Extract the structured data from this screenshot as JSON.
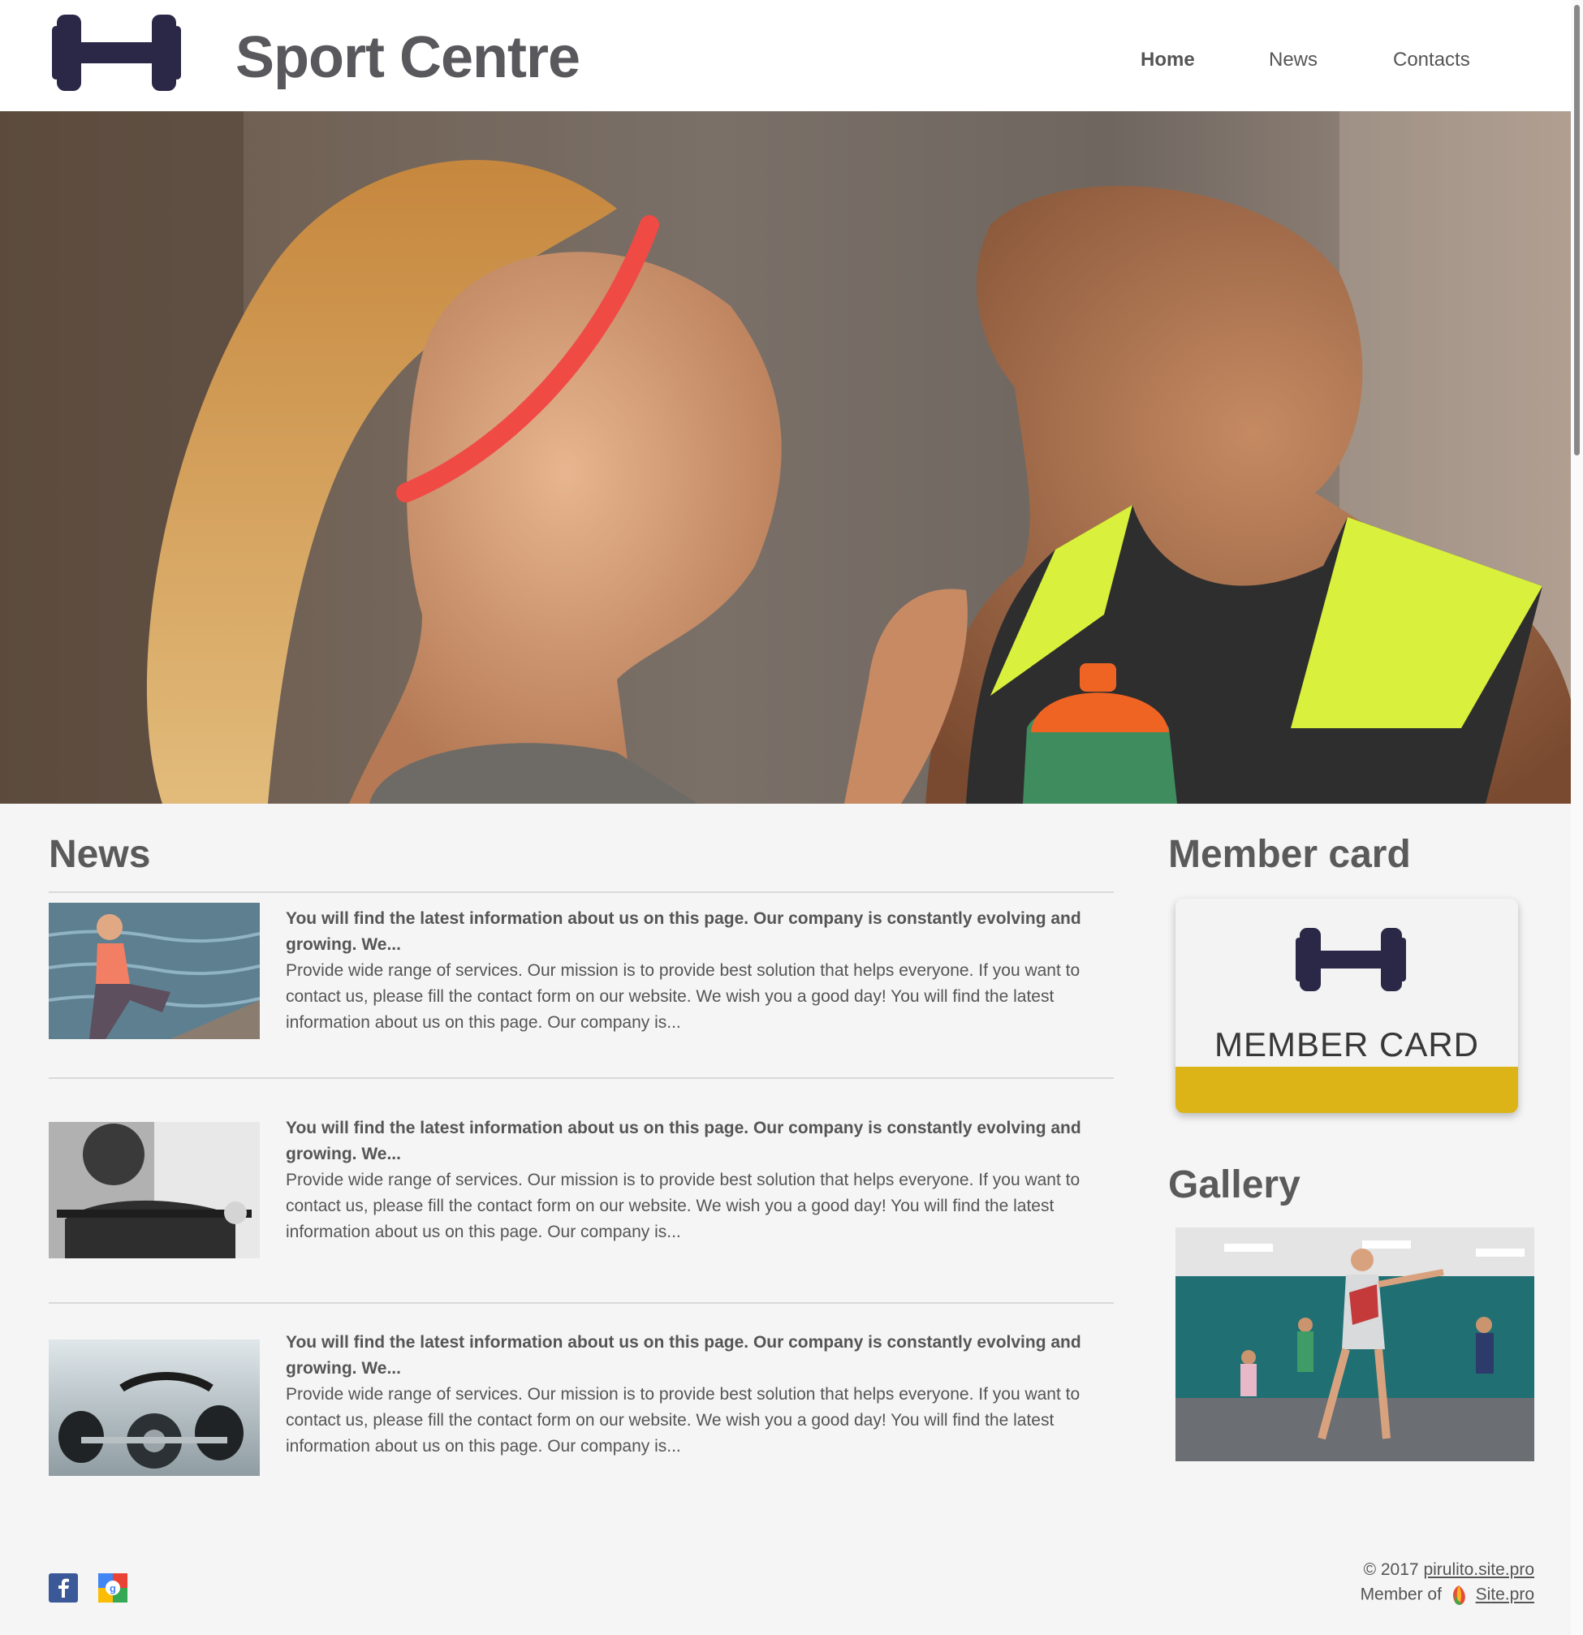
{
  "header": {
    "title": "Sport Centre",
    "nav": [
      {
        "label": "Home",
        "active": true
      },
      {
        "label": "News",
        "active": false
      },
      {
        "label": "Contacts",
        "active": false
      }
    ]
  },
  "colors": {
    "logo": "#2a2747",
    "card_stripe": "#dcb418",
    "background": "#f5f5f5"
  },
  "news": {
    "heading": "News",
    "items": [
      {
        "title": "You will find the latest information about us on this page. Our company is constantly evolving and growing. We...",
        "body": "Provide wide range of services. Our mission is to provide best solution that helps everyone. If you want to contact us, please fill the contact form on our website. We wish you a good day! You will find the latest information about us on this page. Our company is..."
      },
      {
        "title": "You will find the latest information about us on this page. Our company is constantly evolving and growing. We...",
        "body": "Provide wide range of services. Our mission is to provide best solution that helps everyone. If you want to contact us, please fill the contact form on our website. We wish you a good day! You will find the latest information about us on this page. Our company is..."
      },
      {
        "title": "You will find the latest information about us on this page. Our company is constantly evolving and growing. We...",
        "body": "Provide wide range of services. Our mission is to provide best solution that helps everyone. If you want to contact us, please fill the contact form on our website. We wish you a good day! You will find the latest information about us on this page. Our company is..."
      }
    ]
  },
  "sidebar": {
    "member_heading": "Member card",
    "member_card_label": "MEMBER CARD",
    "gallery_heading": "Gallery"
  },
  "footer": {
    "copyright": "© 2017",
    "copyright_link": "pirulito.site.pro",
    "member_of": "Member of",
    "member_link": "Site.pro",
    "social_icons": [
      "facebook-icon",
      "google-plus-icon"
    ]
  }
}
